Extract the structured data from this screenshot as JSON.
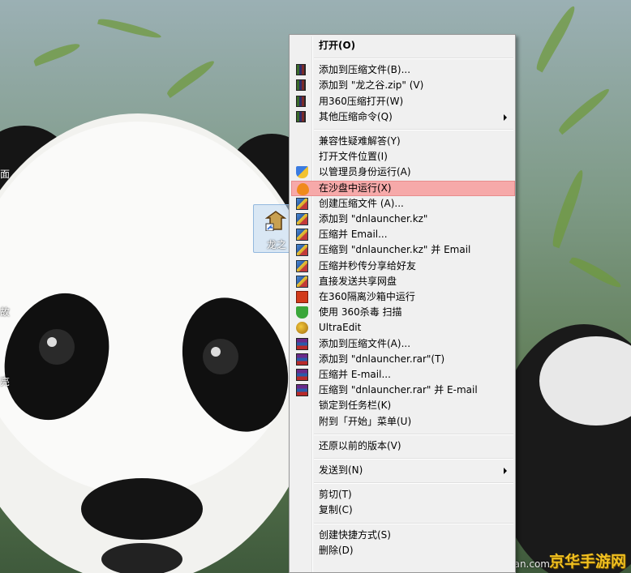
{
  "desktop": {
    "icon_label": "龙之",
    "edge_labels": [
      "面",
      "故",
      "亮"
    ]
  },
  "menu": {
    "items": [
      {
        "label": "打开(O)",
        "bold": true,
        "icon": "none"
      },
      {
        "sep": true
      },
      {
        "label": "添加到压缩文件(B)...",
        "icon": "rar-book-icon"
      },
      {
        "label": "添加到 \"龙之谷.zip\" (V)",
        "icon": "rar-book-icon"
      },
      {
        "label": "用360压缩打开(W)",
        "icon": "rar-book-icon"
      },
      {
        "label": "其他压缩命令(Q)",
        "icon": "rar-book-icon",
        "submenu": true
      },
      {
        "sep": true
      },
      {
        "label": "兼容性疑难解答(Y)",
        "icon": "none"
      },
      {
        "label": "打开文件位置(I)",
        "icon": "none"
      },
      {
        "label": "以管理员身份运行(A)",
        "icon": "uac-shield-icon"
      },
      {
        "label": "在沙盘中运行(X)",
        "icon": "sandbox-icon",
        "highlighted": true
      },
      {
        "label": "创建压缩文件 (A)...",
        "icon": "kz-archive-icon"
      },
      {
        "label": "添加到 \"dnlauncher.kz\"",
        "icon": "kz-archive-icon"
      },
      {
        "label": "压缩并 Email...",
        "icon": "kz-archive-icon"
      },
      {
        "label": "压缩到 \"dnlauncher.kz\" 并 Email",
        "icon": "kz-archive-icon"
      },
      {
        "label": "压缩并秒传分享给好友",
        "icon": "kz-archive-icon"
      },
      {
        "label": "直接发送共享网盘",
        "icon": "kz-archive-icon"
      },
      {
        "label": "在360隔离沙箱中运行",
        "icon": "isolation-box-icon"
      },
      {
        "label": "使用 360杀毒 扫描",
        "icon": "antivirus-shield-icon"
      },
      {
        "label": "UltraEdit",
        "icon": "ultraedit-icon"
      },
      {
        "label": "添加到压缩文件(A)...",
        "icon": "winrar-icon"
      },
      {
        "label": "添加到 \"dnlauncher.rar\"(T)",
        "icon": "winrar-icon"
      },
      {
        "label": "压缩并 E-mail...",
        "icon": "winrar-icon"
      },
      {
        "label": "压缩到 \"dnlauncher.rar\" 并 E-mail",
        "icon": "winrar-icon"
      },
      {
        "label": "锁定到任务栏(K)",
        "icon": "none"
      },
      {
        "label": "附到「开始」菜单(U)",
        "icon": "none"
      },
      {
        "sep": true
      },
      {
        "label": "还原以前的版本(V)",
        "icon": "none"
      },
      {
        "sep": true
      },
      {
        "label": "发送到(N)",
        "icon": "none",
        "submenu": true
      },
      {
        "sep": true
      },
      {
        "label": "剪切(T)",
        "icon": "none"
      },
      {
        "label": "复制(C)",
        "icon": "none"
      },
      {
        "sep": true
      },
      {
        "label": "创建快捷方式(S)",
        "icon": "none"
      },
      {
        "label": "删除(D)",
        "icon": "none"
      }
    ]
  },
  "watermark": {
    "brand": "京华手游网",
    "url": "bbs.duowan.com"
  },
  "colors": {
    "highlight": "#f6a9a9",
    "menu_bg": "#f0f0f0"
  }
}
